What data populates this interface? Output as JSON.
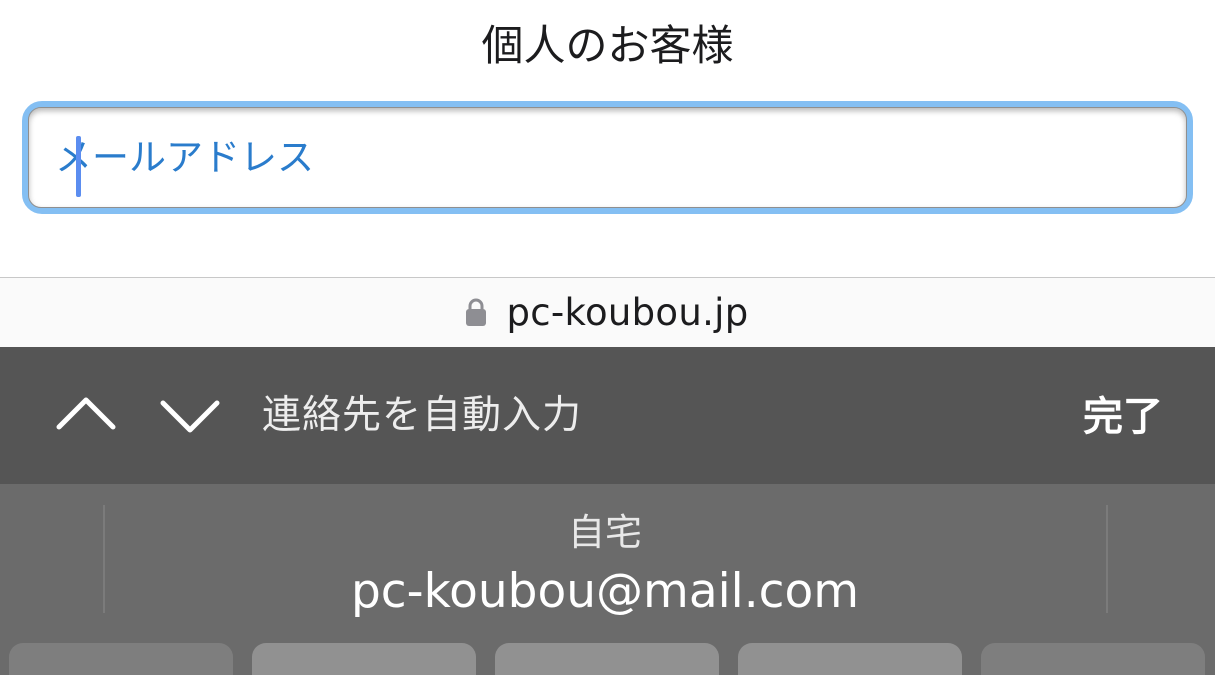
{
  "page": {
    "title": "個人のお客様",
    "email_input": {
      "placeholder": "メールアドレス",
      "value": ""
    }
  },
  "browser": {
    "url": "pc-koubou.jp",
    "secure_icon": "lock-icon"
  },
  "keyboard_accessory": {
    "prev_icon": "chevron-up-icon",
    "next_icon": "chevron-down-icon",
    "autofill_label": "連絡先を自動入力",
    "done_label": "完了"
  },
  "autofill_suggestion": {
    "label": "自宅",
    "email": "pc-koubou@mail.com"
  },
  "colors": {
    "focus_ring": "#84bff3",
    "placeholder_text": "#2a7ccc",
    "accessory_bar": "#555555",
    "suggestion_bar": "#6b6b6b"
  }
}
